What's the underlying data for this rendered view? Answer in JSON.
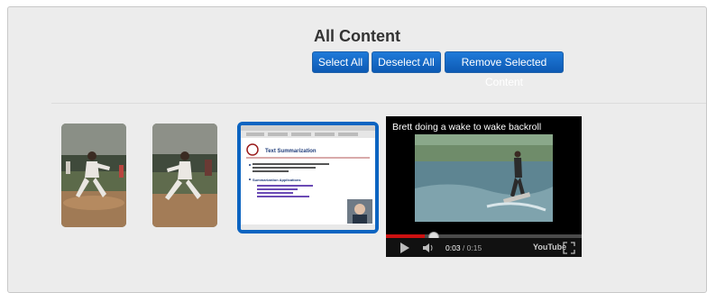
{
  "header": {
    "title": "All Content"
  },
  "actions": {
    "select_all": "Select All",
    "deselect_all": "Deselect All",
    "remove_selected": "Remove Selected Content"
  },
  "items": [
    {
      "type": "image",
      "subject": "baseball pitcher photo"
    },
    {
      "type": "image",
      "subject": "baseball pitcher photo"
    },
    {
      "type": "slide",
      "selected": true,
      "heading": "Text Summarization",
      "subheading": "Summarization Applications"
    },
    {
      "type": "video",
      "title": "Brett doing a wake to wake backroll",
      "current_time": "0:03",
      "duration": "0:15",
      "progress": 0.2
    }
  ],
  "colors": {
    "accent": "#0c64c1",
    "button": "#1467c4",
    "progress": "#cc1111"
  }
}
